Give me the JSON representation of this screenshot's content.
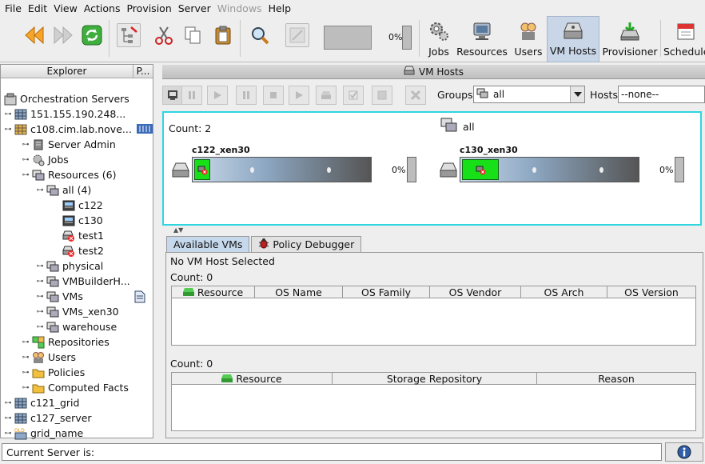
{
  "menu": [
    "File",
    "Edit",
    "View",
    "Actions",
    "Provision",
    "Server",
    "Windows",
    "Help"
  ],
  "menu_disabled": [
    false,
    false,
    false,
    false,
    false,
    true,
    true,
    false
  ],
  "menu_mnemonic": [
    "F",
    "E",
    "V",
    "",
    "P",
    "S",
    "W",
    "H"
  ],
  "toolbar": {
    "progress_pct": "0%",
    "nav": [
      "Jobs",
      "Resources",
      "Users",
      "VM Hosts",
      "Provisioner",
      "Schedule"
    ]
  },
  "explorer": {
    "header": "Explorer",
    "header2": "P...",
    "nodes": [
      "Orchestration Servers",
      "151.155.190.248...",
      "c108.cim.lab.nove...",
      "Server Admin",
      "Jobs",
      "Resources (6)",
      "all (4)",
      "c122",
      "c130",
      "test1",
      "test2",
      "physical",
      "VMBuilderH...",
      "VMs",
      "VMs_xen30",
      "warehouse",
      "Repositories",
      "Users",
      "Policies",
      "Computed Facts",
      "c121_grid",
      "c127_server",
      "grid_name"
    ]
  },
  "vmhosts": {
    "title": "VM Hosts",
    "groups_label": "Groups",
    "groups_value": "all",
    "hosts_label": "Hosts",
    "hosts_value": "--none--",
    "count": "Count: 2",
    "group_name": "all",
    "hosts": [
      {
        "name": "c122_xen30",
        "pct": "0%"
      },
      {
        "name": "c130_xen30",
        "pct": "0%"
      }
    ]
  },
  "tabs": [
    "Available VMs",
    "Policy Debugger"
  ],
  "available": {
    "status": "No VM Host Selected",
    "count1": "Count: 0",
    "cols1": [
      "Resource",
      "OS Name",
      "OS Family",
      "OS Vendor",
      "OS Arch",
      "OS Version"
    ],
    "count2": "Count: 0",
    "cols2": [
      "Resource",
      "Storage Repository",
      "Reason"
    ]
  },
  "status": {
    "text": "Current Server is:"
  },
  "colors": {
    "accent_border": "#2fd6e0",
    "vm_green": "#18e018",
    "active_nav": "#c9d6e8"
  }
}
